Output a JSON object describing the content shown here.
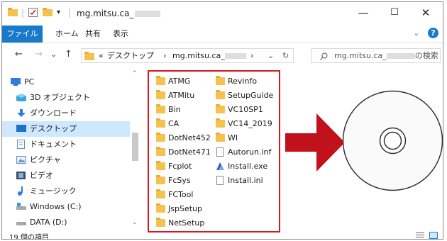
{
  "window": {
    "title": "mg.mitsu.ca_",
    "controls": {
      "minimize": "—",
      "maximize": "☐",
      "close": "✕"
    }
  },
  "ribbon": {
    "tabs": [
      "ファイル",
      "ホーム",
      "共有",
      "表示"
    ],
    "expand": "⌄",
    "help": "?"
  },
  "navbar": {
    "back": "←",
    "forward": "→",
    "dropdown": "⌄",
    "up": "↑",
    "address_prefix": "«",
    "address_desktop": "デスクトップ",
    "address_sep1": "›",
    "address_folder": "mg.mitsu.ca_",
    "address_sep2": "›",
    "address_dropdown": "⌄",
    "refresh": "↻",
    "search_placeholder_start": "mg.mitsu.ca_",
    "search_placeholder_end": "の検索"
  },
  "sidebar": {
    "items": [
      {
        "label": "PC",
        "icon": "pc-icon"
      },
      {
        "label": "3D オブジェクト",
        "icon": "3d-objects-icon"
      },
      {
        "label": "ダウンロード",
        "icon": "download-icon"
      },
      {
        "label": "デスクトップ",
        "icon": "desktop-icon",
        "selected": true
      },
      {
        "label": "ドキュメント",
        "icon": "documents-icon"
      },
      {
        "label": "ピクチャ",
        "icon": "pictures-icon"
      },
      {
        "label": "ビデオ",
        "icon": "video-icon"
      },
      {
        "label": "ミュージック",
        "icon": "music-icon"
      },
      {
        "label": "Windows (C:)",
        "icon": "drive-icon"
      },
      {
        "label": "DATA (D:)",
        "icon": "drive-icon"
      }
    ]
  },
  "files": {
    "col1": [
      "ATMG",
      "ATMitu",
      "Bin",
      "CA",
      "DotNet452",
      "DotNet471",
      "Fcplot",
      "FcSys",
      "FCTool",
      "JspSetup",
      "NetSetup"
    ],
    "col2_folders": [
      "Revinfo",
      "SetupGuide",
      "VC10SP1",
      "VC14_2019",
      "WI"
    ],
    "col2_files": [
      "Autorun.inf",
      "Install.exe",
      "Install.ini"
    ]
  },
  "status": {
    "item_count": "19 個の項目"
  },
  "colors": {
    "accent": "#1979ca",
    "highlight": "#d6181f",
    "arrow": "#c1121c",
    "selected_bg": "#cde8ff"
  }
}
